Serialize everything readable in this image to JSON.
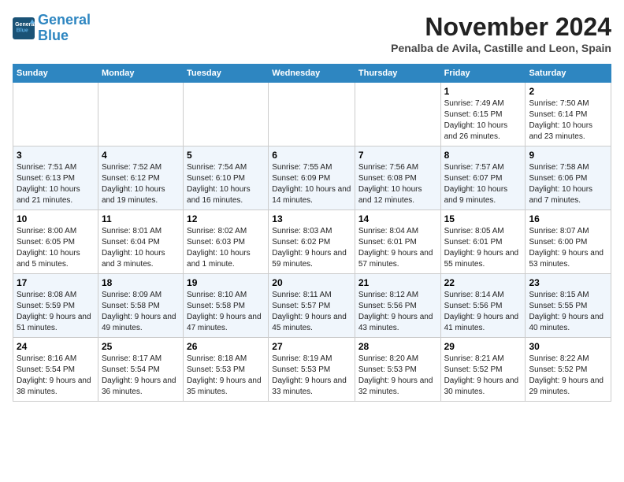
{
  "header": {
    "logo_line1": "General",
    "logo_line2": "Blue",
    "month_title": "November 2024",
    "subtitle": "Penalba de Avila, Castille and Leon, Spain"
  },
  "weekdays": [
    "Sunday",
    "Monday",
    "Tuesday",
    "Wednesday",
    "Thursday",
    "Friday",
    "Saturday"
  ],
  "weeks": [
    [
      {
        "day": "",
        "info": ""
      },
      {
        "day": "",
        "info": ""
      },
      {
        "day": "",
        "info": ""
      },
      {
        "day": "",
        "info": ""
      },
      {
        "day": "",
        "info": ""
      },
      {
        "day": "1",
        "info": "Sunrise: 7:49 AM\nSunset: 6:15 PM\nDaylight: 10 hours and 26 minutes."
      },
      {
        "day": "2",
        "info": "Sunrise: 7:50 AM\nSunset: 6:14 PM\nDaylight: 10 hours and 23 minutes."
      }
    ],
    [
      {
        "day": "3",
        "info": "Sunrise: 7:51 AM\nSunset: 6:13 PM\nDaylight: 10 hours and 21 minutes."
      },
      {
        "day": "4",
        "info": "Sunrise: 7:52 AM\nSunset: 6:12 PM\nDaylight: 10 hours and 19 minutes."
      },
      {
        "day": "5",
        "info": "Sunrise: 7:54 AM\nSunset: 6:10 PM\nDaylight: 10 hours and 16 minutes."
      },
      {
        "day": "6",
        "info": "Sunrise: 7:55 AM\nSunset: 6:09 PM\nDaylight: 10 hours and 14 minutes."
      },
      {
        "day": "7",
        "info": "Sunrise: 7:56 AM\nSunset: 6:08 PM\nDaylight: 10 hours and 12 minutes."
      },
      {
        "day": "8",
        "info": "Sunrise: 7:57 AM\nSunset: 6:07 PM\nDaylight: 10 hours and 9 minutes."
      },
      {
        "day": "9",
        "info": "Sunrise: 7:58 AM\nSunset: 6:06 PM\nDaylight: 10 hours and 7 minutes."
      }
    ],
    [
      {
        "day": "10",
        "info": "Sunrise: 8:00 AM\nSunset: 6:05 PM\nDaylight: 10 hours and 5 minutes."
      },
      {
        "day": "11",
        "info": "Sunrise: 8:01 AM\nSunset: 6:04 PM\nDaylight: 10 hours and 3 minutes."
      },
      {
        "day": "12",
        "info": "Sunrise: 8:02 AM\nSunset: 6:03 PM\nDaylight: 10 hours and 1 minute."
      },
      {
        "day": "13",
        "info": "Sunrise: 8:03 AM\nSunset: 6:02 PM\nDaylight: 9 hours and 59 minutes."
      },
      {
        "day": "14",
        "info": "Sunrise: 8:04 AM\nSunset: 6:01 PM\nDaylight: 9 hours and 57 minutes."
      },
      {
        "day": "15",
        "info": "Sunrise: 8:05 AM\nSunset: 6:01 PM\nDaylight: 9 hours and 55 minutes."
      },
      {
        "day": "16",
        "info": "Sunrise: 8:07 AM\nSunset: 6:00 PM\nDaylight: 9 hours and 53 minutes."
      }
    ],
    [
      {
        "day": "17",
        "info": "Sunrise: 8:08 AM\nSunset: 5:59 PM\nDaylight: 9 hours and 51 minutes."
      },
      {
        "day": "18",
        "info": "Sunrise: 8:09 AM\nSunset: 5:58 PM\nDaylight: 9 hours and 49 minutes."
      },
      {
        "day": "19",
        "info": "Sunrise: 8:10 AM\nSunset: 5:58 PM\nDaylight: 9 hours and 47 minutes."
      },
      {
        "day": "20",
        "info": "Sunrise: 8:11 AM\nSunset: 5:57 PM\nDaylight: 9 hours and 45 minutes."
      },
      {
        "day": "21",
        "info": "Sunrise: 8:12 AM\nSunset: 5:56 PM\nDaylight: 9 hours and 43 minutes."
      },
      {
        "day": "22",
        "info": "Sunrise: 8:14 AM\nSunset: 5:56 PM\nDaylight: 9 hours and 41 minutes."
      },
      {
        "day": "23",
        "info": "Sunrise: 8:15 AM\nSunset: 5:55 PM\nDaylight: 9 hours and 40 minutes."
      }
    ],
    [
      {
        "day": "24",
        "info": "Sunrise: 8:16 AM\nSunset: 5:54 PM\nDaylight: 9 hours and 38 minutes."
      },
      {
        "day": "25",
        "info": "Sunrise: 8:17 AM\nSunset: 5:54 PM\nDaylight: 9 hours and 36 minutes."
      },
      {
        "day": "26",
        "info": "Sunrise: 8:18 AM\nSunset: 5:53 PM\nDaylight: 9 hours and 35 minutes."
      },
      {
        "day": "27",
        "info": "Sunrise: 8:19 AM\nSunset: 5:53 PM\nDaylight: 9 hours and 33 minutes."
      },
      {
        "day": "28",
        "info": "Sunrise: 8:20 AM\nSunset: 5:53 PM\nDaylight: 9 hours and 32 minutes."
      },
      {
        "day": "29",
        "info": "Sunrise: 8:21 AM\nSunset: 5:52 PM\nDaylight: 9 hours and 30 minutes."
      },
      {
        "day": "30",
        "info": "Sunrise: 8:22 AM\nSunset: 5:52 PM\nDaylight: 9 hours and 29 minutes."
      }
    ]
  ]
}
